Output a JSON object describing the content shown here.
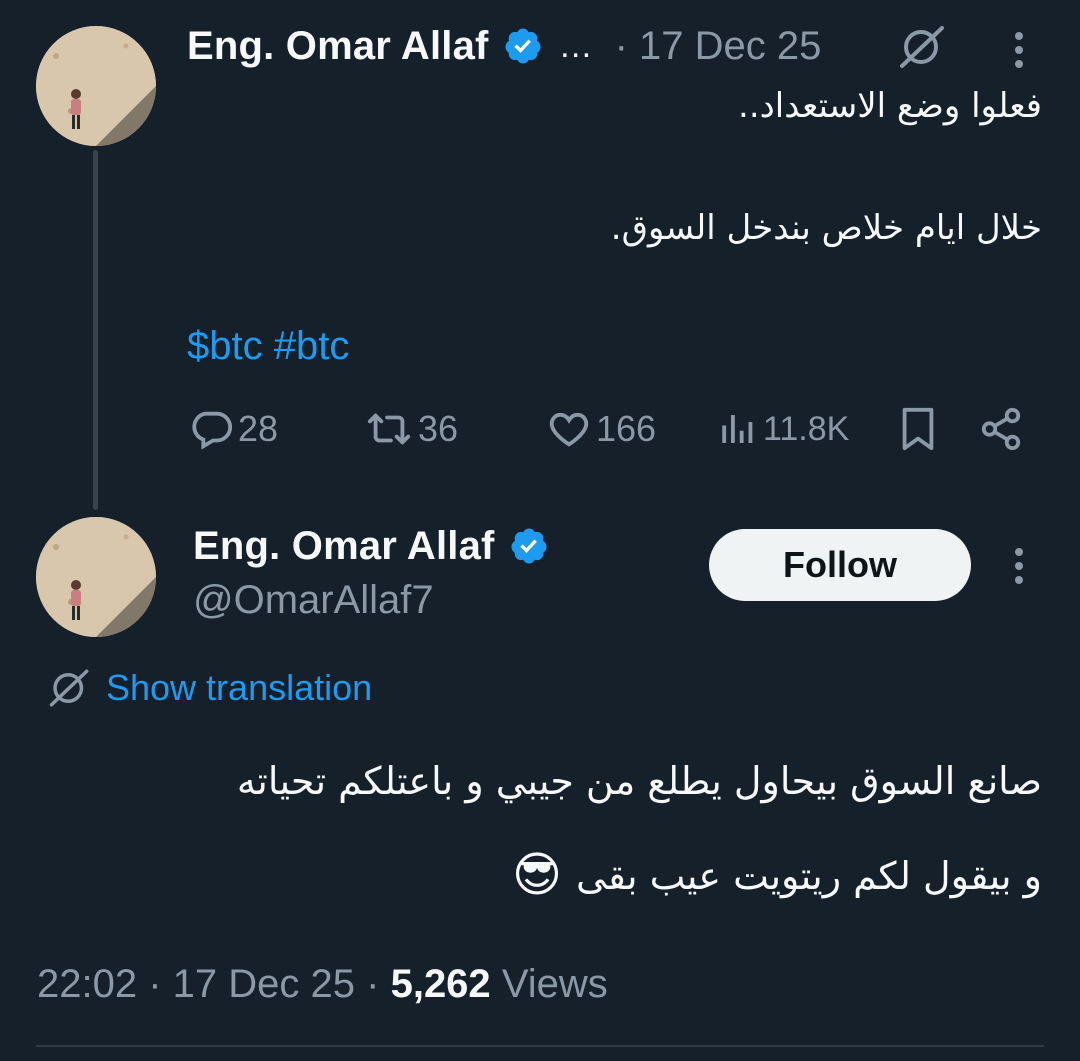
{
  "reply_parent": {
    "author_name": "Eng. Omar Allaf",
    "ellipsis": "…",
    "timestamp": "· 17 Dec 25",
    "lines": [
      "فعلوا وضع الاستعداد..",
      "خلال ايام خلاص بندخل السوق."
    ],
    "tags": "$btc #btc",
    "stats": {
      "replies": "28",
      "reposts": "36",
      "likes": "166",
      "views": "11.8K"
    }
  },
  "main_tweet": {
    "author_name": "Eng. Omar Allaf",
    "handle": "@OmarAllaf7",
    "follow_label": "Follow",
    "show_translation": "Show translation",
    "body_line1": "صانع السوق بيحاول يطلع من جيبي و باعتلكم تحياته",
    "body_line2": "و بيقول لكم ريتويت عيب بقى",
    "emoji": "😎",
    "time": "22:02",
    "date": "· 17 Dec 25 ·",
    "views_count": "5,262",
    "views_label": "Views"
  },
  "colors": {
    "background": "#15202b",
    "accent": "#1d9bf0",
    "muted": "#8b98a5",
    "verified": "#1d9bf0"
  },
  "icons": [
    "verified-badge-icon",
    "translate-icon",
    "more-icon",
    "reply-icon",
    "repost-icon",
    "like-icon",
    "views-icon",
    "bookmark-icon",
    "share-icon"
  ]
}
